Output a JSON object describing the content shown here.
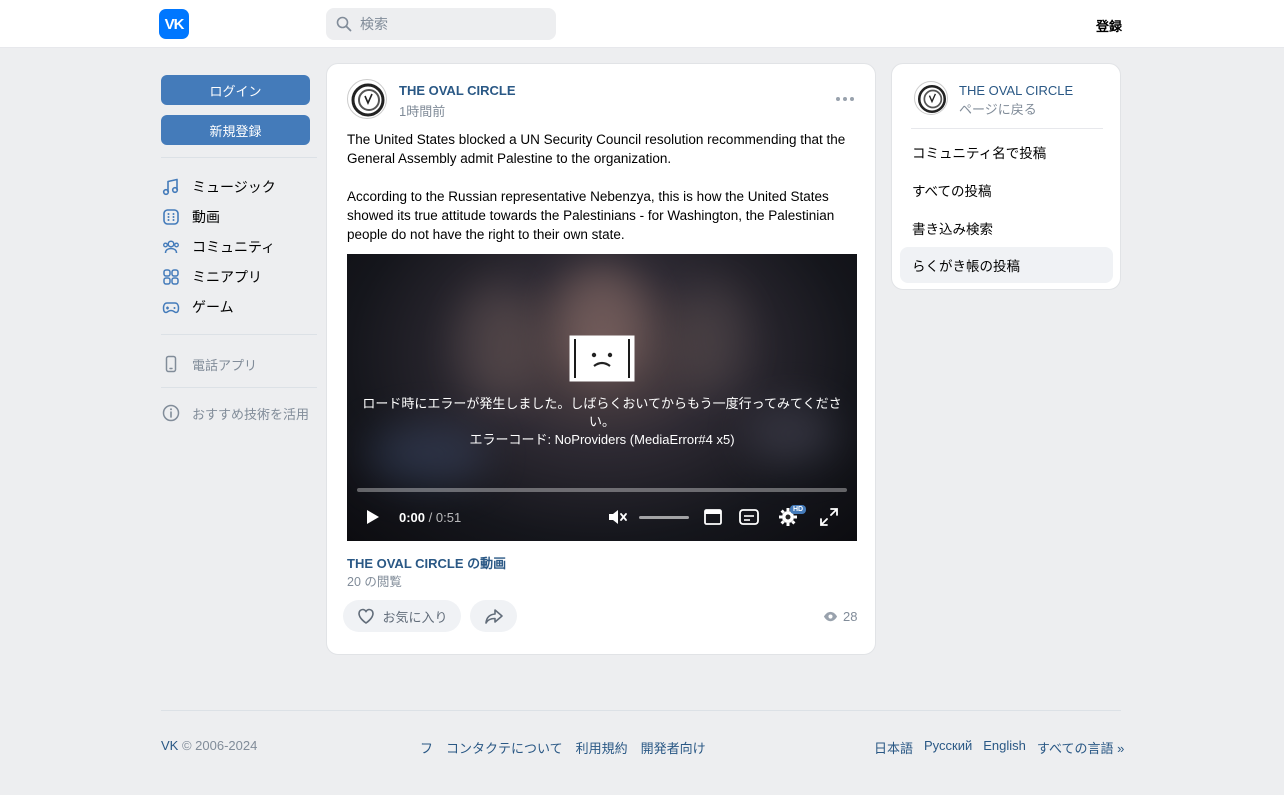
{
  "header": {
    "logo_text": "VK",
    "search_placeholder": "検索",
    "register": "登録"
  },
  "sidebar": {
    "login": "ログイン",
    "signup": "新規登録",
    "items": [
      {
        "label": "ミュージック",
        "icon": "music-note-icon"
      },
      {
        "label": "動画",
        "icon": "video-icon"
      },
      {
        "label": "コミュニティ",
        "icon": "users-icon"
      },
      {
        "label": "ミニアプリ",
        "icon": "apps-icon"
      },
      {
        "label": "ゲーム",
        "icon": "gamepad-icon"
      }
    ],
    "phone_app": "電話アプリ",
    "recommend": "おすすめ技術を活用"
  },
  "post": {
    "author": "THE OVAL CIRCLE",
    "time": "1時間前",
    "paragraph1": "The United States blocked a UN Security Council resolution recommending that the General Assembly admit Palestine to the organization.",
    "paragraph2": "According to the Russian representative Nebenzya, this is how the United States showed its true attitude towards the Palestinians - for Washington, the Palestinian people do not have the right to their own state.",
    "video": {
      "error_message": "ロード時にエラーが発生しました。しばらくおいてからもう一度行ってみてください。",
      "error_code": "エラーコード: NoProviders (MediaError#4 x5)",
      "current_time": "0:00",
      "duration": " / 0:51",
      "hd_badge": "HD"
    },
    "video_title": "THE OVAL CIRCLE の動画",
    "video_views": "20 の閲覧",
    "like_label": "お気に入り",
    "view_count": "28"
  },
  "right_panel": {
    "name": "THE OVAL CIRCLE",
    "back": "ページに戻る",
    "items": [
      "コミュニティ名で投稿",
      "すべての投稿",
      "書き込み検索",
      "らくがき帳の投稿"
    ]
  },
  "footer": {
    "vk": "VK",
    "copyright": " © 2006-2024",
    "links": [
      "フ",
      "コンタクテについて",
      "利用規約",
      "開発者向け"
    ],
    "languages": [
      "日本語",
      "Русский",
      "English",
      "すべての言語 »"
    ]
  },
  "colors": {
    "accent": "#447bba",
    "link": "#2a5885",
    "brand": "#0077ff"
  }
}
